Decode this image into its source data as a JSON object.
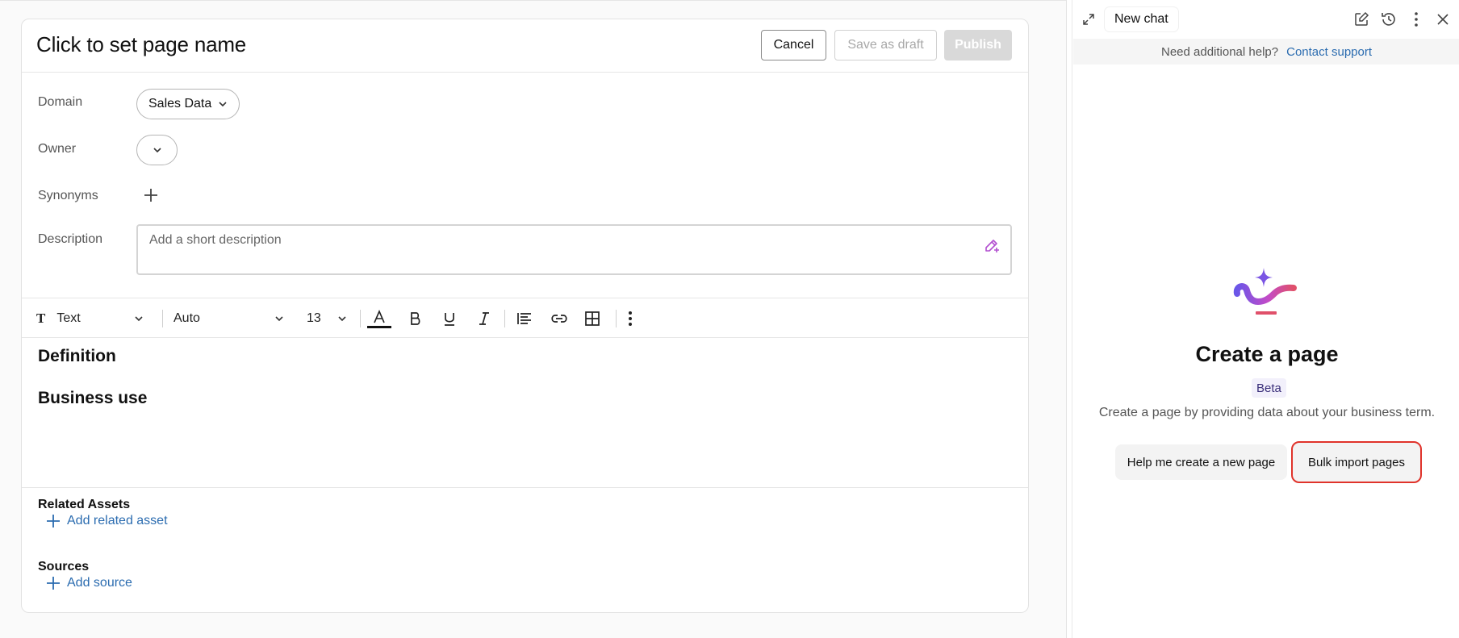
{
  "editor": {
    "title": "Click to set page name",
    "actions": {
      "cancel": "Cancel",
      "save_draft": "Save as draft",
      "publish": "Publish"
    },
    "fields": {
      "domain_label": "Domain",
      "domain_value": "Sales Data",
      "owner_label": "Owner",
      "synonyms_label": "Synonyms",
      "description_label": "Description",
      "description_placeholder": "Add a short description"
    },
    "toolbar": {
      "style": "Text",
      "font": "Auto",
      "size": "13"
    },
    "headings": {
      "definition": "Definition",
      "business_use": "Business use"
    },
    "related_assets": {
      "title": "Related Assets",
      "add": "Add related asset"
    },
    "sources": {
      "title": "Sources",
      "add": "Add source"
    }
  },
  "chat": {
    "tab": "New chat",
    "help_text": "Need additional help?",
    "help_link": "Contact support",
    "title": "Create a page",
    "badge": "Beta",
    "subtitle": "Create a page by providing data about your business term.",
    "suggestions": [
      "Help me create a new page",
      "Bulk import pages"
    ]
  },
  "colors": {
    "link": "#2b6cb0",
    "highlight": "#e0332b",
    "ai_purple": "#7b4fe0",
    "ai_pink": "#d84ab8"
  }
}
